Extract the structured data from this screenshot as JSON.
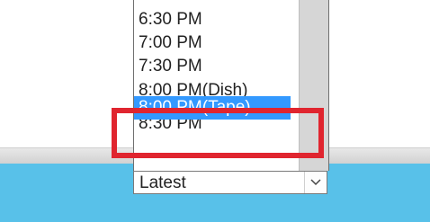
{
  "dropdown": {
    "items": [
      {
        "label": "6:30 PM"
      },
      {
        "label": "7:00 PM"
      },
      {
        "label": "7:30 PM"
      },
      {
        "label": "8:00 PM(Dish)"
      },
      {
        "label": "8:00 PM(Tape)"
      },
      {
        "label": "8:30 PM"
      }
    ],
    "selected_label": "8:00 PM(Tape)",
    "combo_value": "Latest",
    "arrow_icon": "chevron-down"
  },
  "colors": {
    "selection": "#3399ff",
    "highlight": "#e0252f",
    "taskbar": "#58c1e9"
  }
}
